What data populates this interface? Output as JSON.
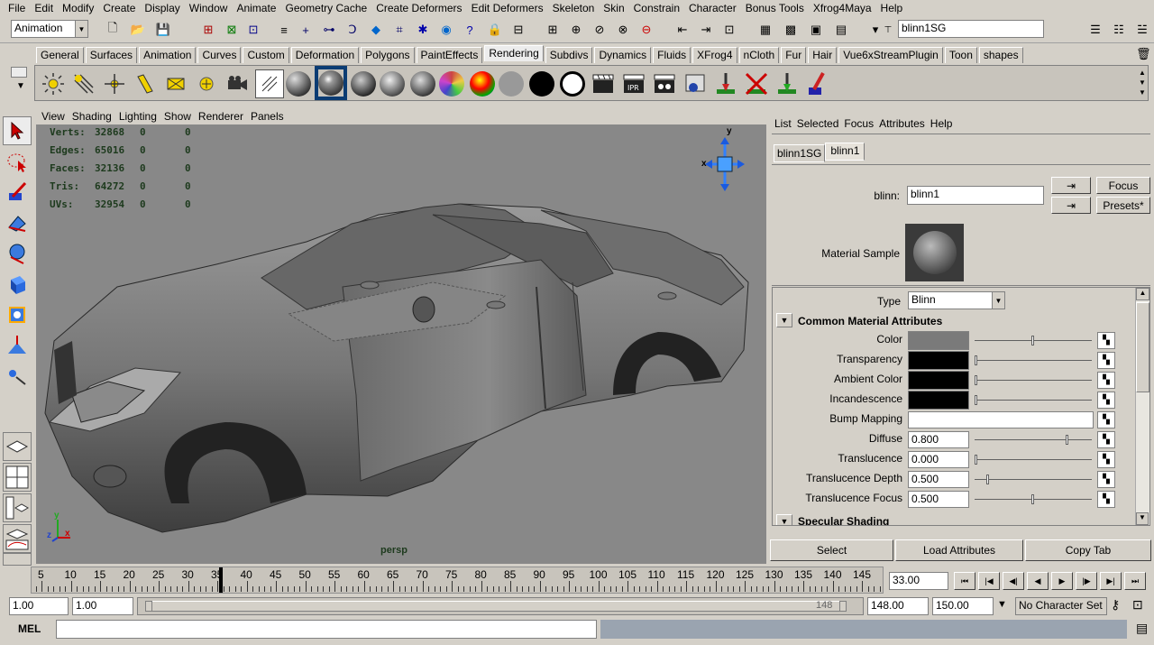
{
  "menu": [
    "File",
    "Edit",
    "Modify",
    "Create",
    "Display",
    "Window",
    "Animate",
    "Geometry Cache",
    "Create Deformers",
    "Edit Deformers",
    "Skeleton",
    "Skin",
    "Constrain",
    "Character",
    "Bonus Tools",
    "Xfrog4Maya",
    "Help"
  ],
  "status": {
    "menuset": "Animation",
    "node_field": "blinn1SG"
  },
  "shelf_tabs": [
    "General",
    "Surfaces",
    "Animation",
    "Curves",
    "Custom",
    "Deformation",
    "Polygons",
    "PaintEffects",
    "Rendering",
    "Subdivs",
    "Dynamics",
    "Fluids",
    "XFrog4",
    "nCloth",
    "Fur",
    "Hair",
    "Vue6xStreamPlugin",
    "Toon",
    "shapes"
  ],
  "active_shelf": "Rendering",
  "viewport": {
    "menu": [
      "View",
      "Shading",
      "Lighting",
      "Show",
      "Renderer",
      "Panels"
    ],
    "hud": [
      {
        "label": "Verts:",
        "v1": "32868",
        "v2": "0",
        "v3": "0"
      },
      {
        "label": "Edges:",
        "v1": "65016",
        "v2": "0",
        "v3": "0"
      },
      {
        "label": "Faces:",
        "v1": "32136",
        "v2": "0",
        "v3": "0"
      },
      {
        "label": "Tris:",
        "v1": "64272",
        "v2": "0",
        "v3": "0"
      },
      {
        "label": "UVs:",
        "v1": "32954",
        "v2": "0",
        "v3": "0"
      }
    ],
    "camera": "persp",
    "axis_y": "y",
    "axis_x": "x",
    "axis_z": "z"
  },
  "attr_editor": {
    "menu": [
      "List",
      "Selected",
      "Focus",
      "Attributes",
      "Help"
    ],
    "tabs": [
      "blinn1SG",
      "blinn1"
    ],
    "node_label": "blinn:",
    "node_name": "blinn1",
    "focus_btn": "Focus",
    "presets_btn": "Presets*",
    "sample_label": "Material Sample",
    "type_label": "Type",
    "type_value": "Blinn",
    "section1": "Common Material Attributes",
    "section2": "Specular Shading",
    "attrs": [
      {
        "label": "Color",
        "value": "",
        "color": "#7a7a7a",
        "slider": 0.5
      },
      {
        "label": "Transparency",
        "value": "",
        "color": "#000000",
        "slider": 0
      },
      {
        "label": "Ambient Color",
        "value": "",
        "color": "#000000",
        "slider": 0
      },
      {
        "label": "Incandescence",
        "value": "",
        "color": "#000000",
        "slider": 0
      },
      {
        "label": "Bump Mapping",
        "value": ""
      },
      {
        "label": "Diffuse",
        "value": "0.800",
        "slider": 0.8
      },
      {
        "label": "Translucence",
        "value": "0.000",
        "slider": 0
      },
      {
        "label": "Translucence Depth",
        "value": "0.500",
        "slider": 0.1
      },
      {
        "label": "Translucence Focus",
        "value": "0.500",
        "slider": 0.5
      }
    ],
    "buttons": [
      "Select",
      "Load Attributes",
      "Copy Tab"
    ]
  },
  "timeline": {
    "ticks": [
      "5",
      "10",
      "15",
      "20",
      "25",
      "30",
      "35",
      "40",
      "45",
      "50",
      "55",
      "60",
      "65",
      "70",
      "75",
      "80",
      "85",
      "90",
      "95",
      "100",
      "105",
      "110",
      "115",
      "120",
      "125",
      "130",
      "135",
      "140",
      "145"
    ],
    "current": "33.00"
  },
  "range": {
    "start": "1.00",
    "min": "1.00",
    "range_end_label": "148",
    "end": "148.00",
    "max": "150.00",
    "character": "No Character Set"
  },
  "cmd": {
    "label": "MEL"
  }
}
